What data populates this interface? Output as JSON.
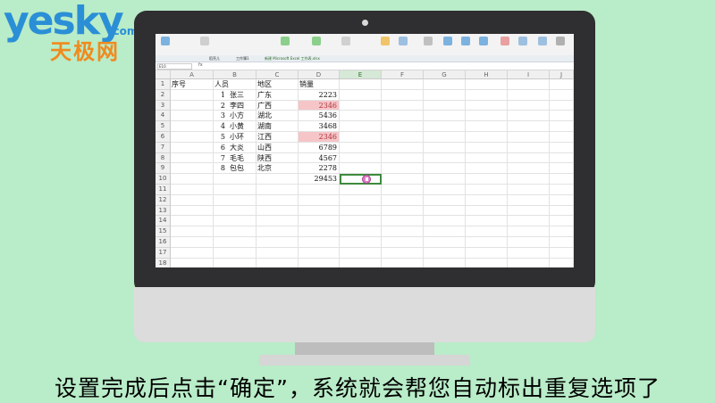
{
  "logo": {
    "main": "yesky",
    "domain": ".com",
    "chinese": "天极网"
  },
  "caption": "设置完成后点击“确定”，系统就会帮您自动标出重复选项了",
  "spreadsheet": {
    "name_box": "E10",
    "fx_label": "fx",
    "tabs": [
      "稻壳儿",
      "工作簿1",
      "新建 Microsoft Excel 工作表.xlsx"
    ],
    "columns": [
      "A",
      "B",
      "C",
      "D",
      "E",
      "F",
      "G",
      "H",
      "I",
      "J"
    ],
    "selected_column": "E",
    "rows": [
      "1",
      "2",
      "3",
      "4",
      "5",
      "6",
      "7",
      "8",
      "9",
      "10",
      "11",
      "12",
      "13",
      "14",
      "15",
      "16",
      "17",
      "18"
    ],
    "headers": {
      "a": "序号",
      "b": "人员",
      "c": "地区",
      "d": "销量"
    },
    "records": [
      {
        "no": "1",
        "name": "张三",
        "region": "广东",
        "sales": "2223",
        "duplicate": false
      },
      {
        "no": "2",
        "name": "李四",
        "region": "广西",
        "sales": "2346",
        "duplicate": true
      },
      {
        "no": "3",
        "name": "小方",
        "region": "湖北",
        "sales": "5436",
        "duplicate": false
      },
      {
        "no": "4",
        "name": "小黄",
        "region": "湖南",
        "sales": "3468",
        "duplicate": false
      },
      {
        "no": "5",
        "name": "小环",
        "region": "江西",
        "sales": "2346",
        "duplicate": true
      },
      {
        "no": "6",
        "name": "大炎",
        "region": "山西",
        "sales": "6789",
        "duplicate": false
      },
      {
        "no": "7",
        "name": "毛毛",
        "region": "陕西",
        "sales": "4567",
        "duplicate": false
      },
      {
        "no": "8",
        "name": "包包",
        "region": "北京",
        "sales": "2278",
        "duplicate": false
      }
    ],
    "total": "29453",
    "duplicate_fill": "#f6c5c8",
    "selection_color": "#3d8a3d"
  }
}
